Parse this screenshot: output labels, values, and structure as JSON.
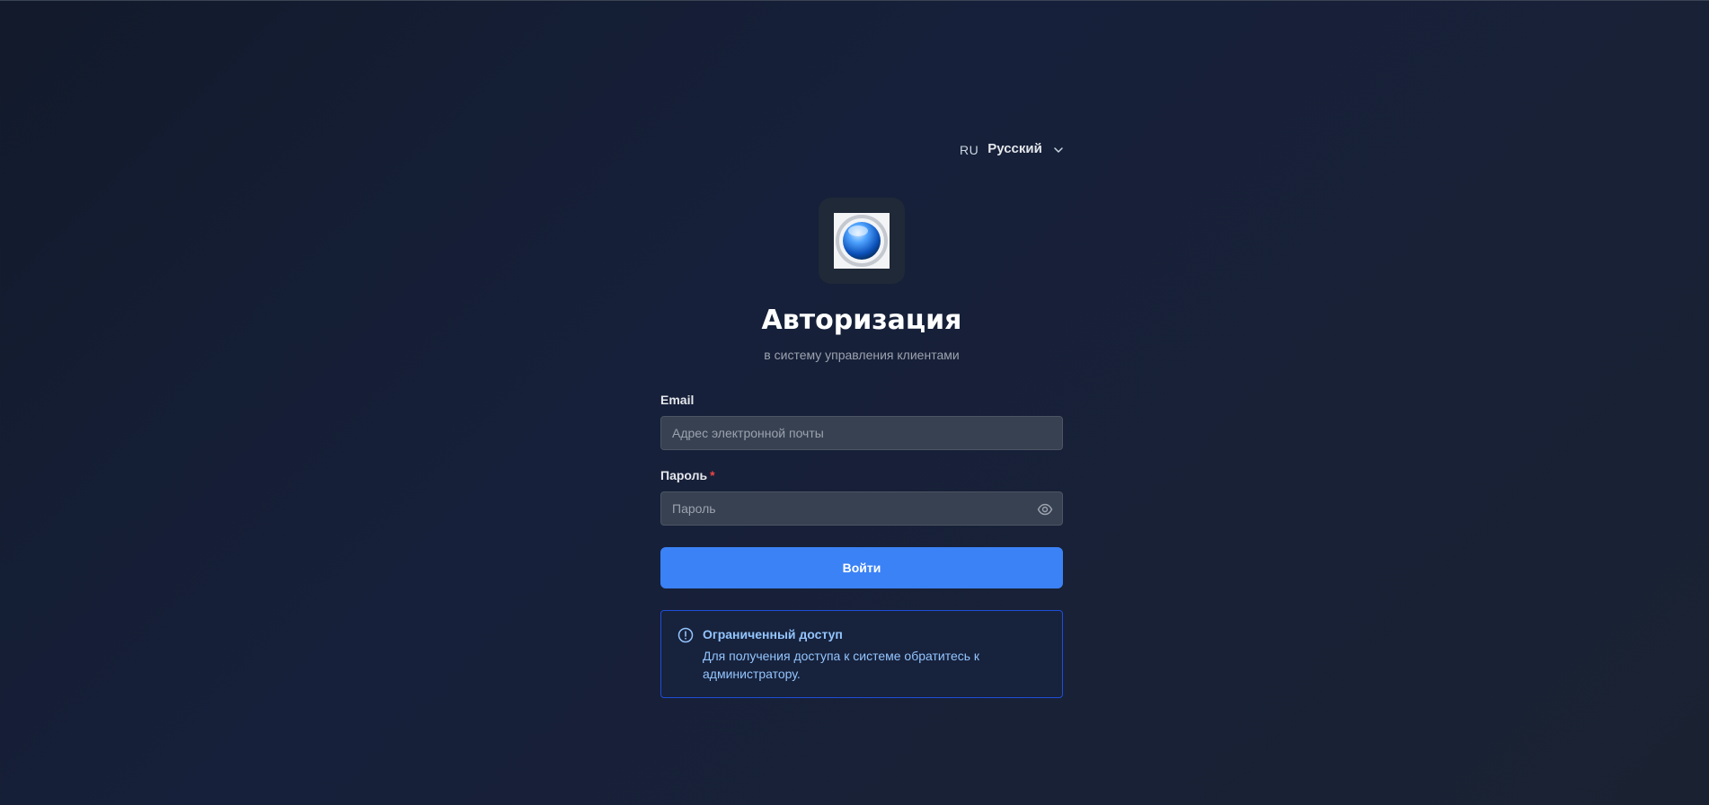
{
  "language": {
    "code": "RU",
    "name": "Русский"
  },
  "header": {
    "title": "Авторизация",
    "subtitle": "в систему управления клиентами"
  },
  "form": {
    "email": {
      "label": "Email",
      "placeholder": "Адрес электронной почты",
      "value": ""
    },
    "password": {
      "label": "Пароль",
      "required_mark": "*",
      "placeholder": "Пароль",
      "value": ""
    },
    "submit_label": "Войти"
  },
  "notice": {
    "title": "Ограниченный доступ",
    "text": "Для получения доступа к системе обратитесь к администратору."
  },
  "colors": {
    "accent": "#3b82f6",
    "notice_border": "#1d4ed8",
    "notice_text": "#93c5fd",
    "required": "#ef4444"
  }
}
